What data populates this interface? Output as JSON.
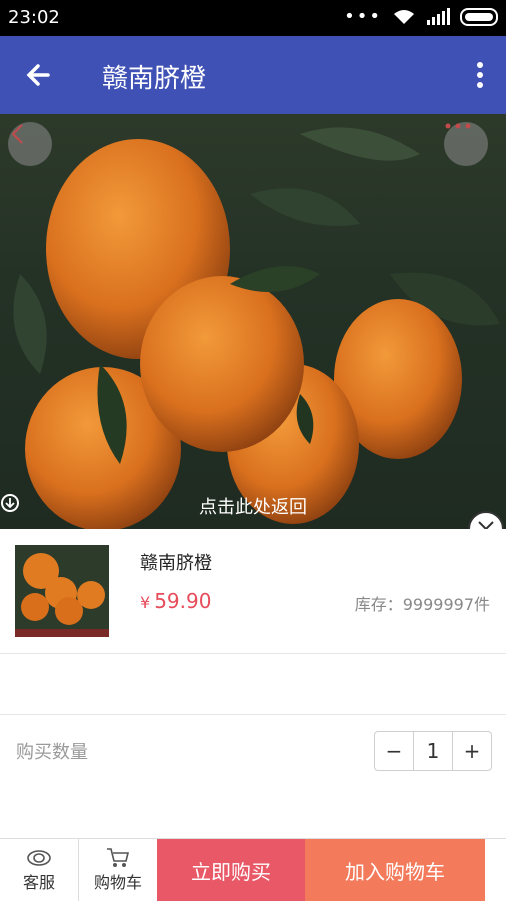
{
  "status_bar": {
    "time": "23:02"
  },
  "header": {
    "title": "赣南脐橙"
  },
  "hero": {
    "return_tip": "点击此处返回"
  },
  "product": {
    "name": "赣南脐橙",
    "currency": "¥",
    "price": "59.90",
    "stock": "库存：9999997件"
  },
  "quantity": {
    "label": "购买数量",
    "value": "1",
    "minus": "−",
    "plus": "+"
  },
  "bottom_bar": {
    "service_label": "客服",
    "cart_label": "购物车",
    "buy_now": "立即购买",
    "add_to_cart": "加入购物车"
  },
  "colors": {
    "header": "#3f51b5",
    "price": "#e74c5b",
    "buy_now": "#e85867",
    "add_to_cart": "#f37a5a"
  }
}
